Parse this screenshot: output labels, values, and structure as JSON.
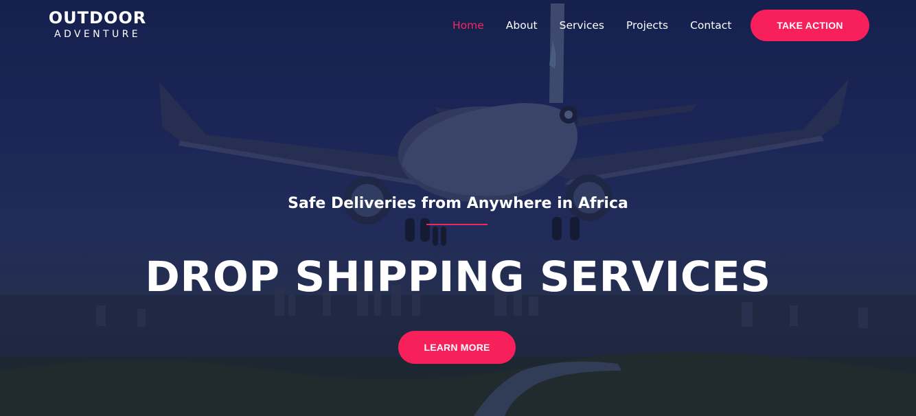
{
  "logo": {
    "line1": "OUTDOOR",
    "line2": "ADVENTURE"
  },
  "nav": {
    "items": [
      {
        "label": "Home",
        "active": true
      },
      {
        "label": "About",
        "active": false
      },
      {
        "label": "Services",
        "active": false
      },
      {
        "label": "Projects",
        "active": false
      },
      {
        "label": "Contact",
        "active": false
      }
    ]
  },
  "header": {
    "cta_label": "TAKE ACTION"
  },
  "hero": {
    "subtitle": "Safe Deliveries from Anywhere in Africa",
    "headline": "DROP SHIPPING SERVICES",
    "cta_label": "LEARN MORE"
  },
  "colors": {
    "accent": "#f7205a",
    "overlay": "#16224e",
    "text": "#ffffff"
  },
  "icons": {
    "background": "airplane-over-city-image"
  }
}
